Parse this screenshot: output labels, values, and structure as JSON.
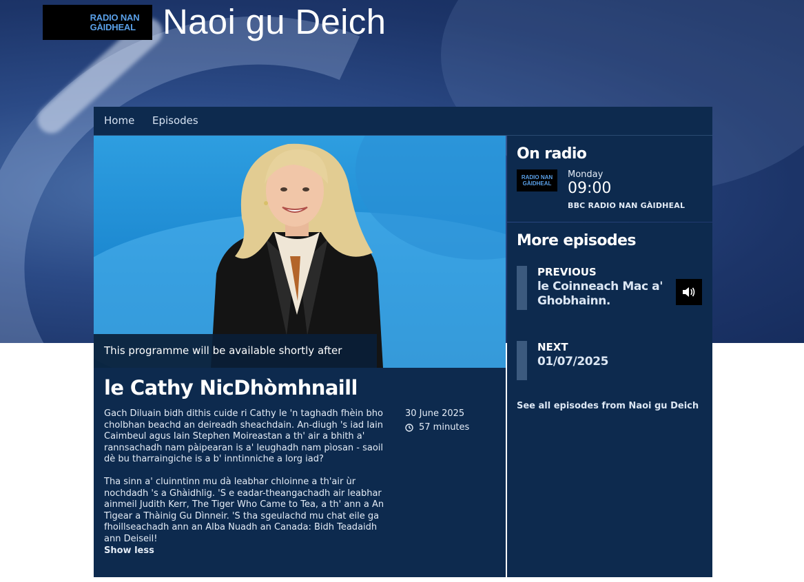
{
  "header": {
    "logo_line1": "RADIO NAN",
    "logo_line2": "GÀIDHEAL",
    "title": "Naoi gu Deich"
  },
  "nav": {
    "items": [
      {
        "label": "Home"
      },
      {
        "label": "Episodes"
      }
    ]
  },
  "hero": {
    "availability": "This programme will be available shortly after broadcast"
  },
  "episode": {
    "title": "le Cathy NicDhòmhnaill",
    "description": [
      "Gach Diluain bidh dithis cuide ri Cathy le 'n taghadh fhèin bho cholbhan beachd an deireadh sheachdain. An-diugh 's iad Iain Caimbeul agus Iain Stephen Moireastan a th' air a bhith a' rannsachadh nam pàipearan is a' leughadh nam pìosan - saoil dè bu tharraingiche is a b' inntinniche a lorg iad?",
      "Tha sinn a' cluinntinn mu dà leabhar chloinne a th'air ùr nochdadh 's a Ghàidhlig. 'S e eadar-theangachadh air leabhar ainmeil Judith Kerr, The Tiger Who Came to Tea, a th' ann a An Tìgear a Thàinig Gu Dìnneir. 'S tha sgeulachd mu chat eile ga fhoillseachadh ann an Alba Nuadh an Canada: Bidh Teadaidh ann Deiseil!"
    ],
    "date": "30 June 2025",
    "duration": "57 minutes",
    "show_less": "Show less"
  },
  "on_radio": {
    "heading": "On radio",
    "logo_line1": "RADIO NAN",
    "logo_line2": "GÀIDHEAL",
    "day": "Monday",
    "time": "09:00",
    "station": "BBC RADIO NAN GÀIDHEAL"
  },
  "more_episodes": {
    "heading": "More episodes",
    "previous_label": "PREVIOUS",
    "previous_line1": "le Coinneach Mac a'",
    "previous_line2": "Ghobhainn.",
    "next_label": "NEXT",
    "next_value": "01/07/2025",
    "see_all": "See all episodes from Naoi gu Deich"
  },
  "colors": {
    "panel": "#0d2a4e",
    "hero_blue": "#1a86cf",
    "logo_blue": "#5aa0e8"
  }
}
